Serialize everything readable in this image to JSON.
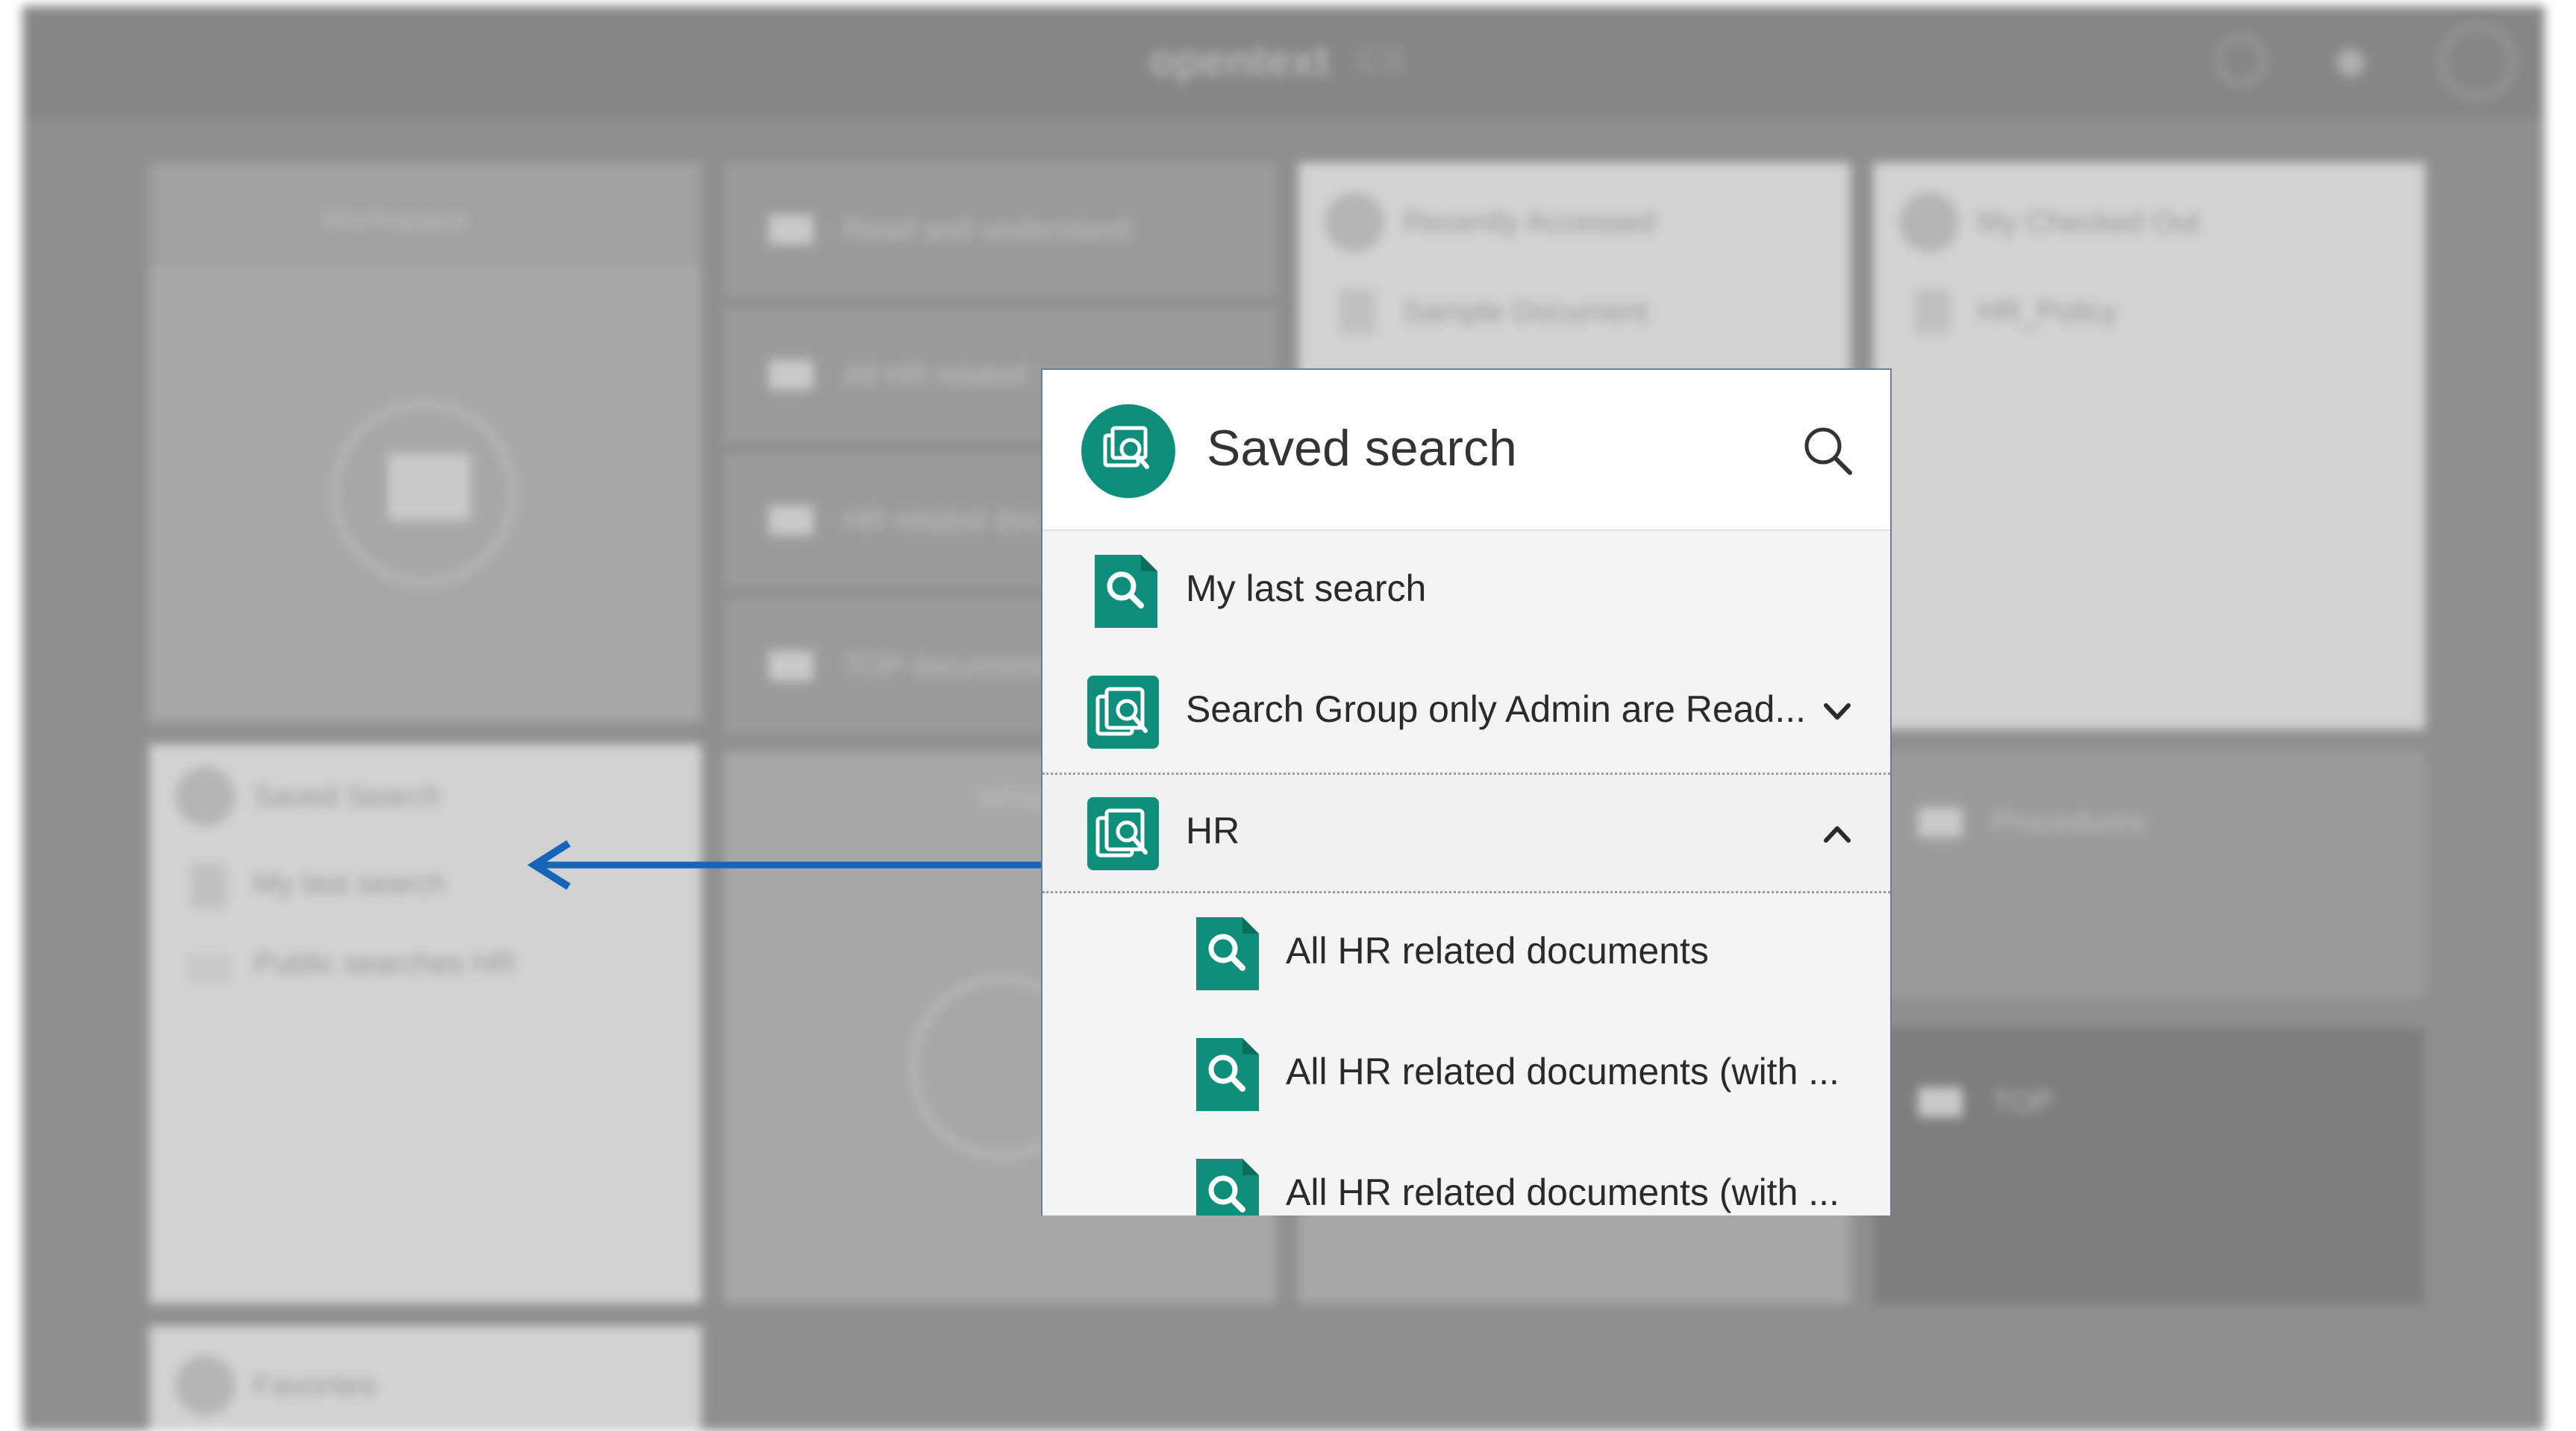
{
  "background_app": {
    "brand": "opentext",
    "brand_suffix": "CS",
    "tiles": {
      "workspace_title": "Workspace",
      "folders": [
        "Read and understand",
        "All HR related",
        "HR related docs",
        "TOP documents"
      ],
      "recently_accessed": "Recently Accessed",
      "recently_accessed_item": "Sample Document",
      "checked_out": "My Checked Out",
      "checked_out_item": "HR_Policy",
      "saved_search": "Saved Search",
      "saved_search_items": [
        "My last search",
        "Public searches HR"
      ],
      "favorites": "Favorites",
      "procedures": "Procedures",
      "top": "TOP",
      "what": "What"
    }
  },
  "popup": {
    "title": "Saved search",
    "items": [
      {
        "label": "My last search",
        "type": "search",
        "level": 0
      },
      {
        "label": "Search Group only Admin are Read...",
        "type": "group",
        "state": "collapsed",
        "level": 0
      },
      {
        "label": "HR",
        "type": "group",
        "state": "expanded",
        "level": 0
      },
      {
        "label": "All HR related documents",
        "type": "search",
        "level": 1
      },
      {
        "label": "All HR related documents (with ...",
        "type": "search",
        "level": 1
      },
      {
        "label": "All HR related documents (with ...",
        "type": "search",
        "level": 1
      }
    ]
  },
  "icons": {
    "header": "saved-search-group-icon",
    "search_item": "saved-search-document-icon",
    "group_item": "saved-search-group-icon",
    "header_action": "search-icon",
    "collapsed": "chevron-down-icon",
    "expanded": "chevron-up-icon"
  },
  "colors": {
    "accent": "#0f8f7b",
    "arrow": "#1565b8",
    "popup_border": "#6a7f96"
  }
}
